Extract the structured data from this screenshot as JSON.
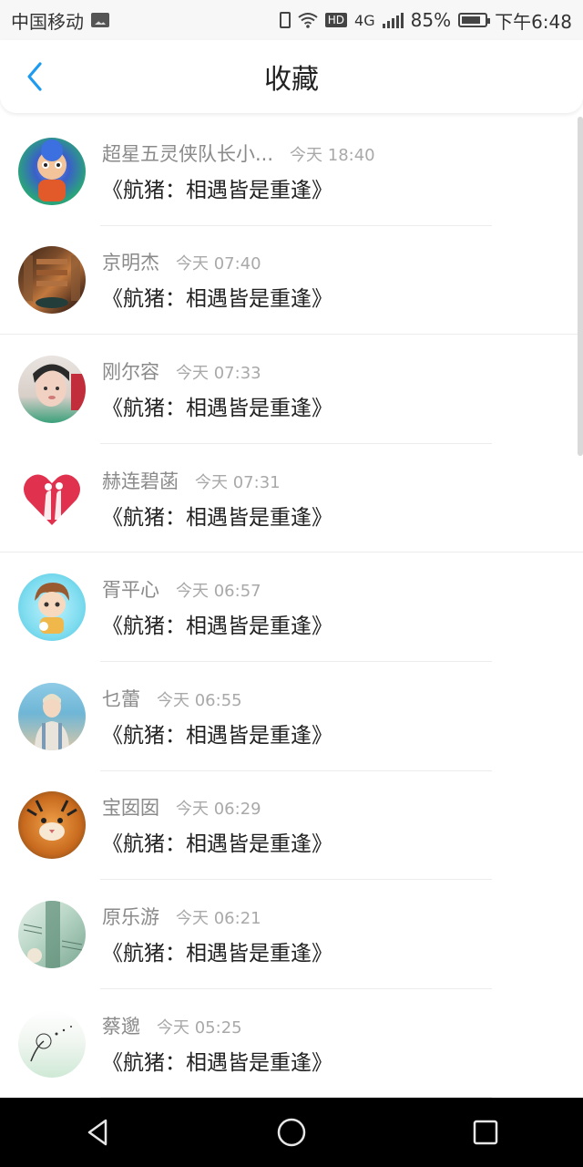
{
  "status_bar": {
    "carrier": "中国移动",
    "network": "4G",
    "hd_label": "HD",
    "battery_percent": "85%",
    "time": "下午6:48"
  },
  "header": {
    "title": "收藏"
  },
  "items": [
    {
      "name": "超星五灵侠队长小...",
      "time": "今天 18:40",
      "message": "《航猪：相遇皆是重逢》"
    },
    {
      "name": "京明杰",
      "time": "今天 07:40",
      "message": "《航猪：相遇皆是重逢》"
    },
    {
      "name": "刚尔容",
      "time": "今天 07:33",
      "message": "《航猪：相遇皆是重逢》"
    },
    {
      "name": "赫连碧菡",
      "time": "今天 07:31",
      "message": "《航猪：相遇皆是重逢》"
    },
    {
      "name": "胥平心",
      "time": "今天 06:57",
      "message": "《航猪：相遇皆是重逢》"
    },
    {
      "name": "乜蕾",
      "time": "今天 06:55",
      "message": "《航猪：相遇皆是重逢》"
    },
    {
      "name": "宝囡囡",
      "time": "今天 06:29",
      "message": "《航猪：相遇皆是重逢》"
    },
    {
      "name": "原乐游",
      "time": "今天 06:21",
      "message": "《航猪：相遇皆是重逢》"
    },
    {
      "name": "蔡邈",
      "time": "今天 05:25",
      "message": "《航猪：相遇皆是重逢》"
    }
  ],
  "colors": {
    "accent": "#1e9bf0",
    "name_text": "#8a8a8a",
    "time_text": "#a9a9a9"
  }
}
